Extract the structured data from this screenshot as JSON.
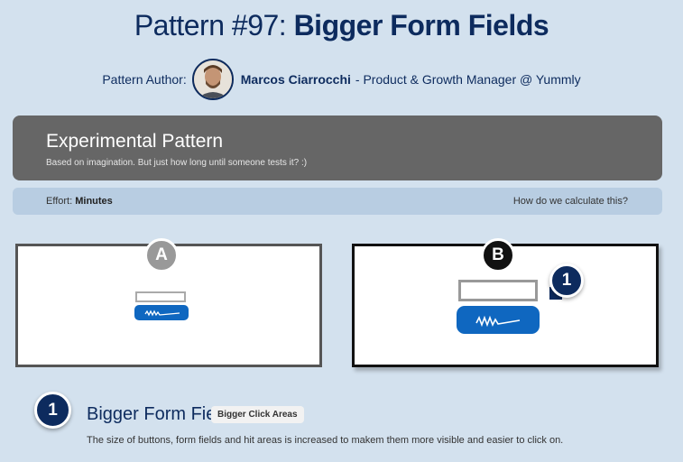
{
  "header": {
    "title_prefix": "Pattern #97:",
    "title_bold": "Bigger Form Fields"
  },
  "author": {
    "label": "Pattern Author:",
    "name": "Marcos Ciarrocchi",
    "role": "- Product & Growth Manager @ Yummly"
  },
  "banner": {
    "heading": "Experimental Pattern",
    "subtext": "Based on imagination. But just how long until someone tests it? :)"
  },
  "effort": {
    "label": "Effort:",
    "value": "Minutes",
    "link": "How do we calculate this?"
  },
  "variants": {
    "a_label": "A",
    "b_label": "B",
    "marker_number": "1"
  },
  "feature": {
    "number": "1",
    "title": "Bigger Form Fields",
    "tag": "Bigger Click Areas",
    "description": "The size of buttons, form fields and hit areas is increased to makem them more visible and easier to click on."
  },
  "colors": {
    "background": "#d3e1ee",
    "navy": "#0d2b5e",
    "banner": "#666666",
    "button_blue": "#0f67c0"
  }
}
